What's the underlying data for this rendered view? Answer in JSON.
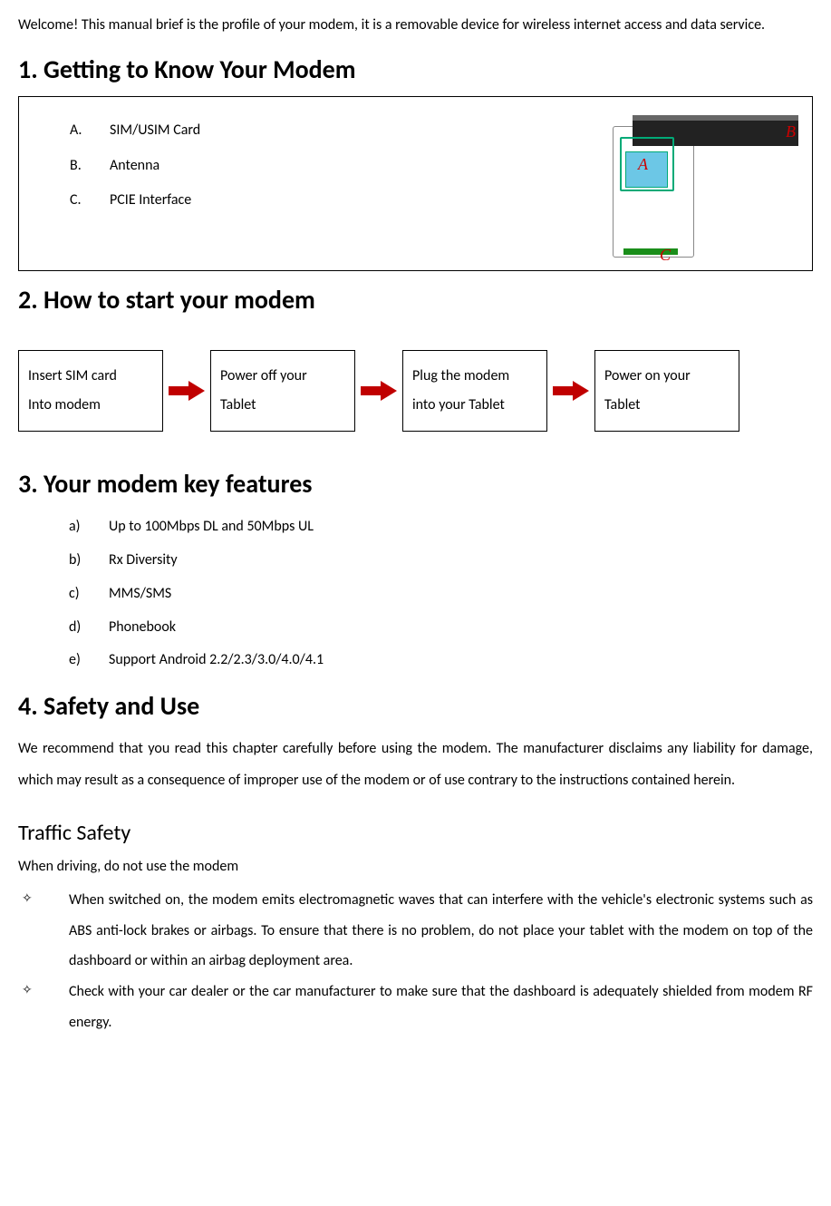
{
  "intro": "Welcome! This manual brief is the profile of your modem, it is a removable device for wireless internet access and data service.",
  "section1": {
    "heading": "1. Getting to Know Your Modem",
    "items": [
      {
        "label": "A.",
        "text": "SIM/USIM Card"
      },
      {
        "label": "B.",
        "text": "Antenna"
      },
      {
        "label": "C.",
        "text": "PCIE Interface"
      }
    ],
    "diagram_labels": {
      "a": "A",
      "b": "B",
      "c": "C"
    }
  },
  "section2": {
    "heading": "2. How to start your modem",
    "steps": [
      {
        "line1": "Insert SIM card",
        "line2": "Into modem"
      },
      {
        "line1": "Power off your",
        "line2": "Tablet"
      },
      {
        "line1": "Plug the modem",
        "line2": "into your Tablet"
      },
      {
        "line1": "Power on your",
        "line2": "Tablet"
      }
    ]
  },
  "section3": {
    "heading": "3. Your modem key features",
    "items": [
      {
        "label": "a)",
        "text": "Up to 100Mbps DL and 50Mbps UL"
      },
      {
        "label": "b)",
        "text": "Rx Diversity"
      },
      {
        "label": "c)",
        "text": "MMS/SMS"
      },
      {
        "label": "d)",
        "text": "Phonebook"
      },
      {
        "label": "e)",
        "text": "Support Android 2.2/2.3/3.0/4.0/4.1"
      }
    ]
  },
  "section4": {
    "heading": "4. Safety and Use",
    "paragraph": "We recommend that you read this chapter carefully before using the modem. The manufacturer disclaims any liability for damage, which may result as a consequence of improper use of the modem or of use contrary to the instructions contained herein.",
    "subheading": "Traffic Safety",
    "subline": "When driving, do not use the modem",
    "bullets": [
      "When switched on, the modem emits electromagnetic waves that can interfere with the vehicle's electronic systems such as ABS anti-lock brakes or airbags. To ensure that there is no problem, do not place your tablet with the modem on top of the dashboard or within an airbag deployment area.",
      "Check with your car dealer or the car manufacturer to make sure that the dashboard is adequately shielded from modem RF energy."
    ]
  },
  "diamond": "✧"
}
